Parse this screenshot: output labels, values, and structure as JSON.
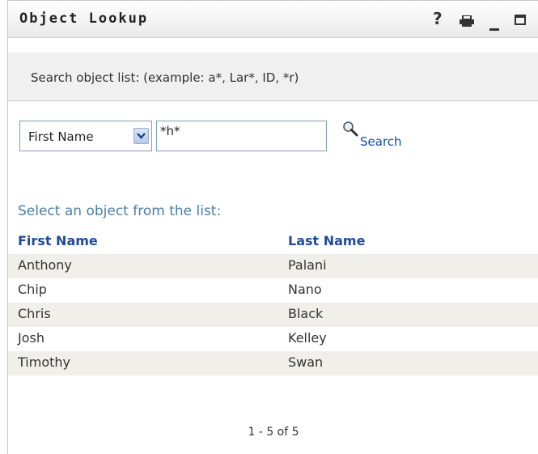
{
  "window": {
    "title": "Object Lookup",
    "help_label": "?"
  },
  "instruction": "Search object list: (example: a*, Lar*, ID, *r)",
  "search": {
    "field_selected": "First Name",
    "query_value": "*h*",
    "button_label": "Search"
  },
  "list_heading": "Select an object from the list:",
  "table": {
    "columns": [
      "First Name",
      "Last Name"
    ],
    "rows": [
      {
        "first": "Anthony",
        "last": "Palani"
      },
      {
        "first": "Chip",
        "last": "Nano"
      },
      {
        "first": "Chris",
        "last": "Black"
      },
      {
        "first": "Josh",
        "last": "Kelley"
      },
      {
        "first": "Timothy",
        "last": "Swan"
      }
    ]
  },
  "pager": "1 - 5 of 5",
  "icons": {
    "help": "help-icon",
    "print": "print-icon",
    "minimize": "minimize-icon",
    "maximize": "maximize-icon",
    "dropdown": "chevron-down-icon",
    "search": "magnifier-icon"
  },
  "colors": {
    "link": "#0a50a1",
    "header_text": "#1f4b99",
    "heading": "#4b7ea8",
    "stripe": "#f0efe9",
    "instruction_bg": "#f0f0f0"
  }
}
